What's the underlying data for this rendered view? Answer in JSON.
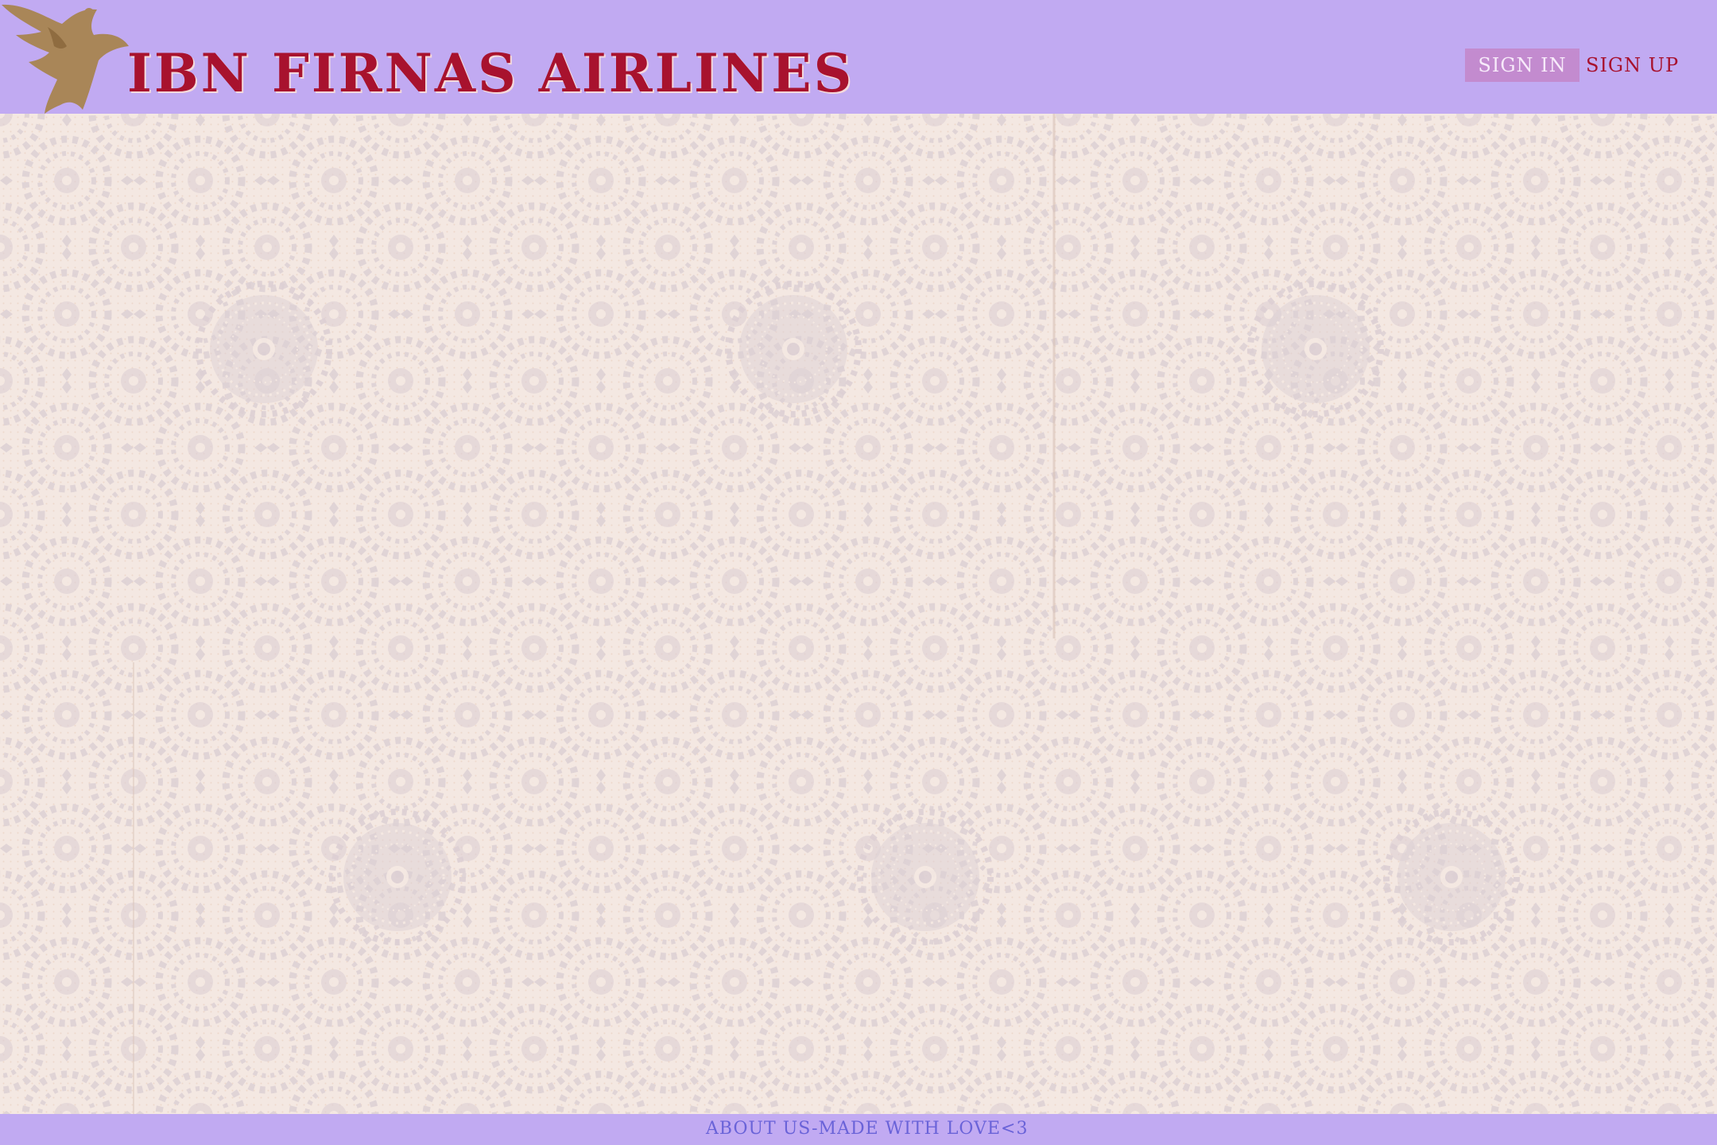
{
  "header": {
    "title": "IBN FIRNAS AIRLINES",
    "logo_icon": "winged-flyer-logo",
    "signin_label": "SIGN IN",
    "signup_label": "SIGN UP"
  },
  "footer": {
    "link_label": "ABOUT US-MADE WITH LOVE<3"
  },
  "colors": {
    "bar": "#c1aaf2",
    "brand": "#a8122e",
    "signin_bg": "#c38bcf",
    "footer_text": "#6a63d8",
    "page_bg": "#f4e8e2",
    "pattern": "#ddd0d4"
  }
}
